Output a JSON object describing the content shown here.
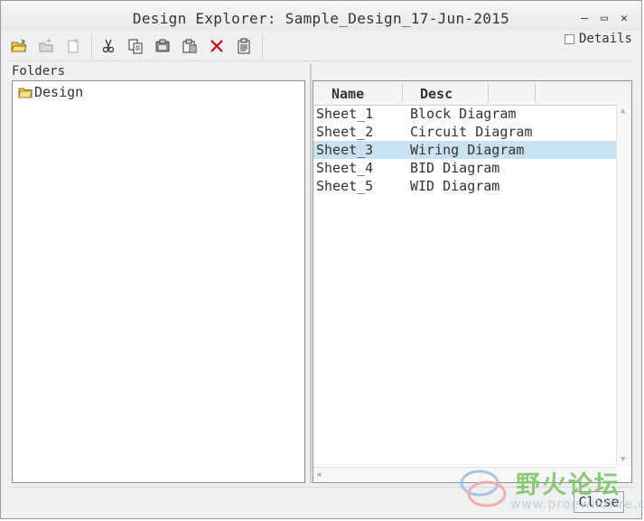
{
  "window": {
    "title": "Design Explorer: Sample_Design_17-Jun-2015",
    "minimize_glyph": "–",
    "maximize_glyph": "▭",
    "close_glyph": "✕"
  },
  "toolbar": {
    "icons": [
      "open-folder-icon",
      "new-folder-icon",
      "new-page-icon",
      "cut-icon",
      "copy-icon",
      "paste-icon",
      "paste-special-icon",
      "delete-icon",
      "properties-icon"
    ],
    "delete_color": "#c8001e"
  },
  "details": {
    "label": "Details",
    "checked": false
  },
  "folders": {
    "label": "Folders",
    "items": [
      {
        "label": "Design",
        "icon": "folder-icon"
      }
    ]
  },
  "list": {
    "columns": [
      "Name",
      "Desc"
    ],
    "rows": [
      {
        "name": "Sheet_1",
        "desc": "Block Diagram",
        "selected": false
      },
      {
        "name": "Sheet_2",
        "desc": "Circuit Diagram",
        "selected": false
      },
      {
        "name": "Sheet_3",
        "desc": "Wiring Diagram",
        "selected": true
      },
      {
        "name": "Sheet_4",
        "desc": "BID Diagram",
        "selected": false
      },
      {
        "name": "Sheet_5",
        "desc": "WID Diagram",
        "selected": false
      }
    ],
    "selected_color": "#c9e2f2"
  },
  "footer": {
    "close_label": "Close"
  },
  "watermark": {
    "text": "野火论坛",
    "url": "www.proewildfire.cn"
  }
}
